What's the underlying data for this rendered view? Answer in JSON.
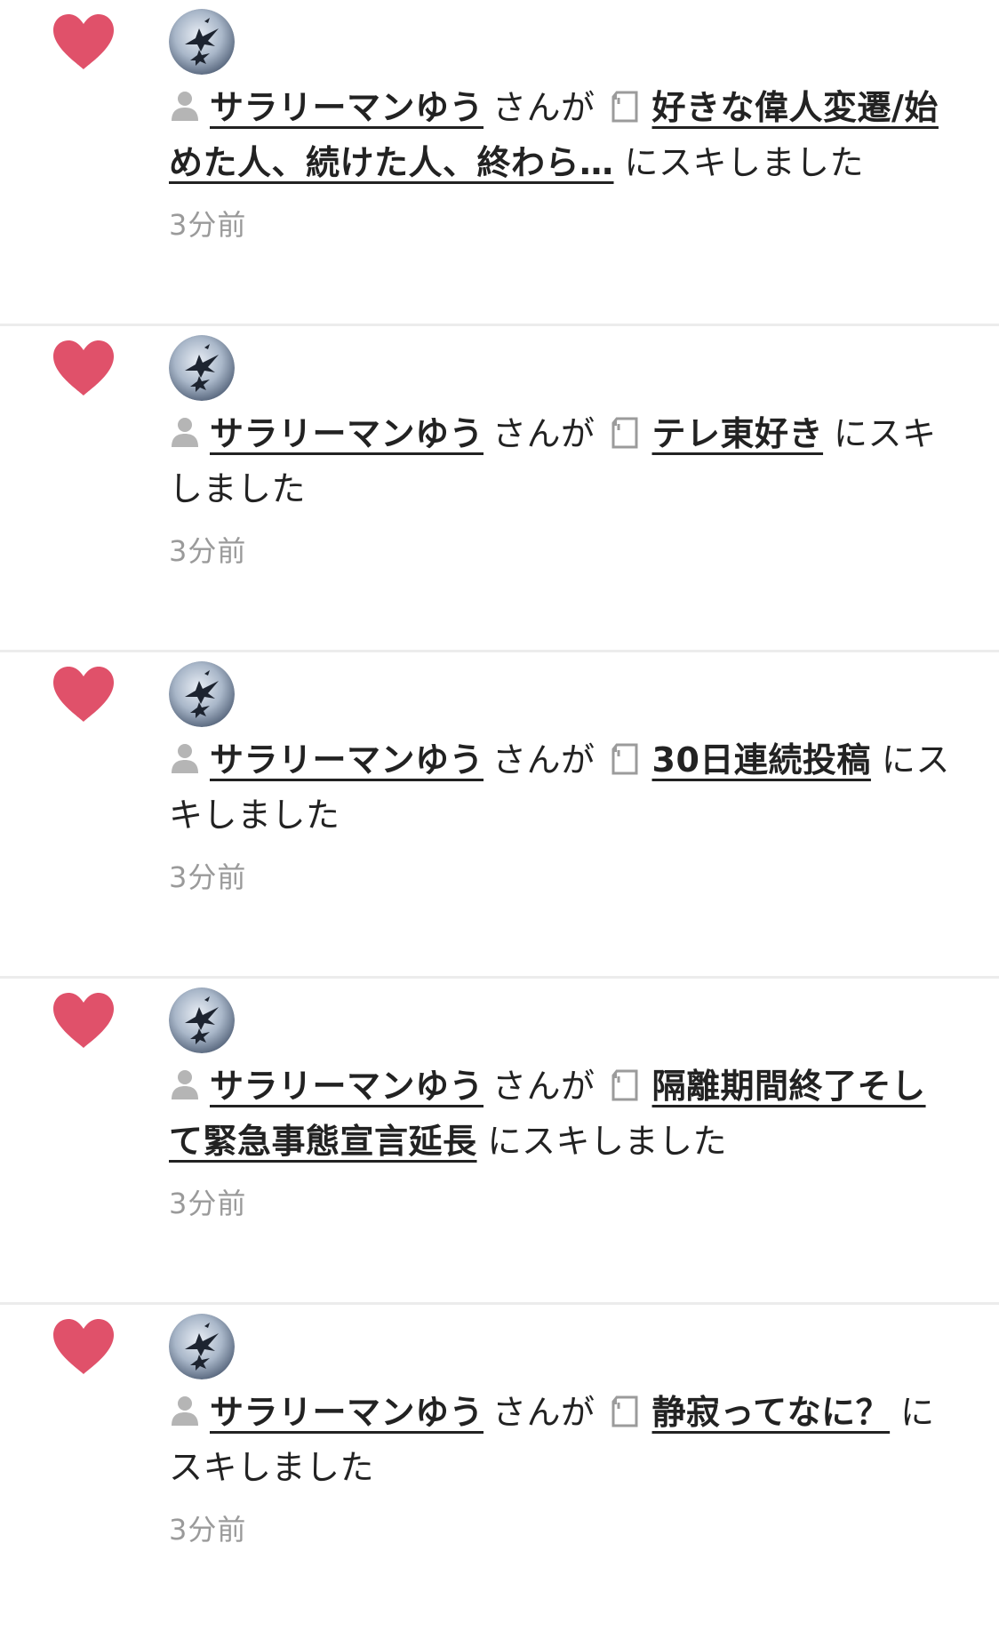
{
  "accent_colors": {
    "heart": "#e0516a",
    "text": "#222222",
    "muted": "#9a9a9a",
    "divider": "#ececec"
  },
  "notifications": [
    {
      "icon": "heart-icon",
      "user_name": "サラリーマンゆう",
      "san_ga": "さんが",
      "note_title": "好きな偉人変遷/始めた人、続けた人、終わら…",
      "suffix": "にスキしました",
      "time": "3分前"
    },
    {
      "icon": "heart-icon",
      "user_name": "サラリーマンゆう",
      "san_ga": "さんが",
      "note_title": "テレ東好き",
      "suffix": "にスキしました",
      "time": "3分前"
    },
    {
      "icon": "heart-icon",
      "user_name": "サラリーマンゆう",
      "san_ga": "さんが",
      "note_title": "30日連続投稿",
      "suffix": "にスキしました",
      "time": "3分前"
    },
    {
      "icon": "heart-icon",
      "user_name": "サラリーマンゆう",
      "san_ga": "さんが",
      "note_title": "隔離期間終了そして緊急事態宣言延長",
      "suffix": "にスキしました",
      "time": "3分前"
    },
    {
      "icon": "heart-icon",
      "user_name": "サラリーマンゆう",
      "san_ga": "さんが",
      "note_title": "静寂ってなに？",
      "suffix": "にスキしました",
      "time": "3分前"
    }
  ]
}
